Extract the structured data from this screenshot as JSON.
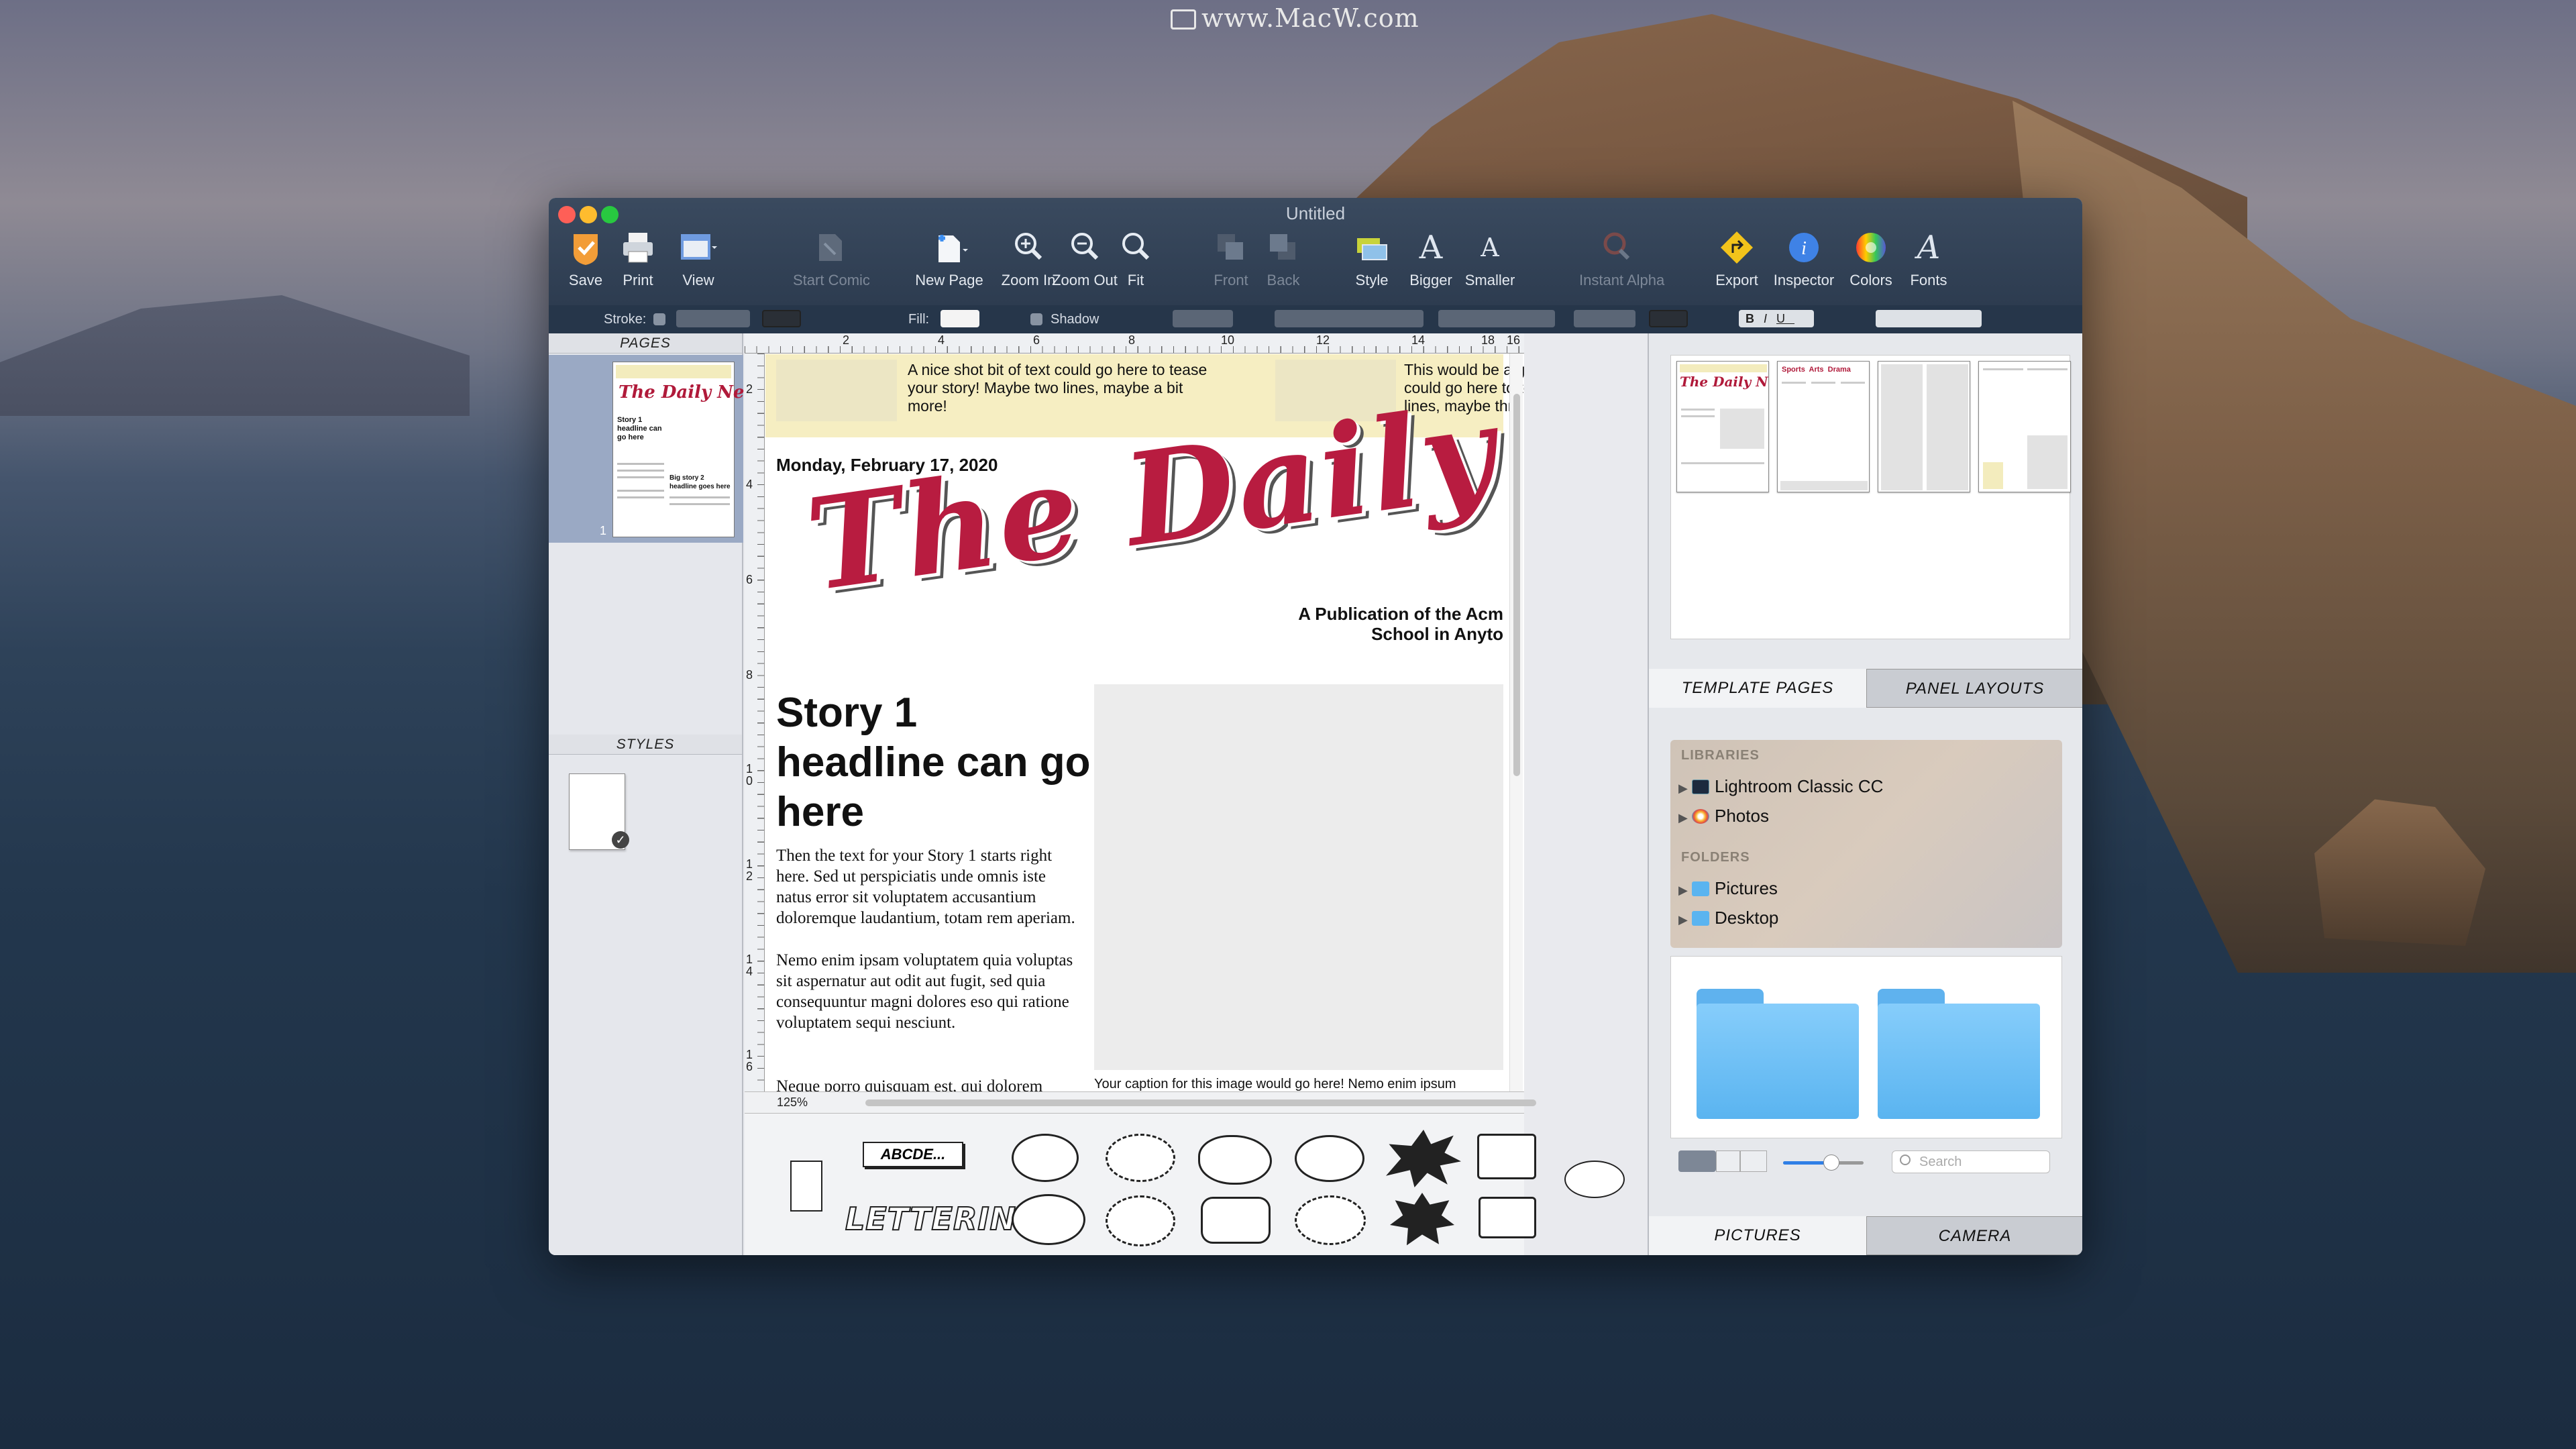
{
  "desktop": {
    "watermark": "www.MacW.com"
  },
  "window": {
    "title": "Untitled"
  },
  "toolbar": {
    "items": [
      {
        "label": "Save",
        "icon": "save-icon",
        "enabled": true
      },
      {
        "label": "Print",
        "icon": "print-icon",
        "enabled": true
      },
      {
        "label": "View",
        "icon": "view-icon",
        "enabled": true
      },
      {
        "label": "Start Comic",
        "icon": "start-comic-icon",
        "enabled": false
      },
      {
        "label": "New Page",
        "icon": "new-page-icon",
        "enabled": true
      },
      {
        "label": "Zoom In",
        "icon": "zoom-in-icon",
        "enabled": true
      },
      {
        "label": "Zoom Out",
        "icon": "zoom-out-icon",
        "enabled": true
      },
      {
        "label": "Fit",
        "icon": "fit-icon",
        "enabled": true
      },
      {
        "label": "Front",
        "icon": "front-icon",
        "enabled": false
      },
      {
        "label": "Back",
        "icon": "back-icon",
        "enabled": false
      },
      {
        "label": "Style",
        "icon": "style-icon",
        "enabled": true
      },
      {
        "label": "Bigger",
        "icon": "bigger-icon",
        "enabled": true
      },
      {
        "label": "Smaller",
        "icon": "smaller-icon",
        "enabled": true
      },
      {
        "label": "Instant Alpha",
        "icon": "instant-alpha-icon",
        "enabled": false
      },
      {
        "label": "Export",
        "icon": "export-icon",
        "enabled": true
      },
      {
        "label": "Inspector",
        "icon": "inspector-icon",
        "enabled": true
      },
      {
        "label": "Colors",
        "icon": "colors-icon",
        "enabled": true
      },
      {
        "label": "Fonts",
        "icon": "fonts-icon",
        "enabled": true
      }
    ]
  },
  "formatbar": {
    "stroke_label": "Stroke:",
    "fill_label": "Fill:",
    "shadow_label": "Shadow",
    "bold": "B",
    "italic": "I",
    "underline": "U"
  },
  "left_panel": {
    "pages_header": "PAGES",
    "styles_header": "STYLES",
    "page_thumb": {
      "title": "The Daily News",
      "story1": "Story 1 headline can go here",
      "story2": "Big story 2 headline goes here",
      "page_number": "1"
    }
  },
  "ruler": {
    "top": [
      "2",
      "4",
      "6",
      "8",
      "10",
      "12",
      "14",
      "16",
      "18"
    ],
    "left": [
      "2",
      "4",
      "6",
      "8",
      "1\n0",
      "1\n2",
      "1\n4",
      "1\n6"
    ]
  },
  "document": {
    "teaser_1": "A nice shot bit of text could go here to tease your story! Maybe two lines, maybe a bit more!",
    "teaser_2": "This would be a great place f text could go here to tease y Maybe two lines, maybe thre",
    "date": "Monday, February 17, 2020",
    "masthead": "The Daily News",
    "publication_line_1": "A Publication of the Acm",
    "publication_line_2": "School in Anyto",
    "headline": "Story 1 headline can go here",
    "paragraph_1": "Then the text for your Story 1 starts right here. Sed ut perspiciatis unde omnis iste natus error sit voluptatem accusantium doloremque laudantium, totam rem aperiam.",
    "paragraph_2": "Nemo enim ipsam voluptatem quia voluptas sit aspernatur aut odit aut fugit, sed quia consequuntur magni dolores eso qui ratione voluptatem sequi nesciunt.",
    "paragraph_3": "Neque porro quisquam est, qui dolorem",
    "caption": "Your caption for this image would go here! Nemo enim ipsum voluptatem quia aspernatur aut odio aut fugit"
  },
  "canvas_footer": {
    "zoom": "125%"
  },
  "balloon_palette": {
    "abcde_label": "ABCDE...",
    "lettering_label": "LETTERING"
  },
  "right_panel": {
    "template_thumbs": [
      {
        "title": "The Daily News"
      },
      {
        "title": "Sports  Arts  Drama"
      },
      {
        "title": ""
      },
      {
        "title": ""
      }
    ],
    "tabs": {
      "template_pages": "TEMPLATE PAGES",
      "panel_layouts": "PANEL LAYOUTS"
    },
    "browser": {
      "libraries_header": "LIBRARIES",
      "libraries": [
        "Lightroom Classic CC",
        "Photos"
      ],
      "folders_header": "FOLDERS",
      "folders": [
        "Pictures",
        "Desktop"
      ]
    },
    "search_placeholder": "Search",
    "zoom_slider_value": 0.6,
    "bottom_tabs": {
      "pictures": "PICTURES",
      "camera": "CAMERA"
    }
  }
}
